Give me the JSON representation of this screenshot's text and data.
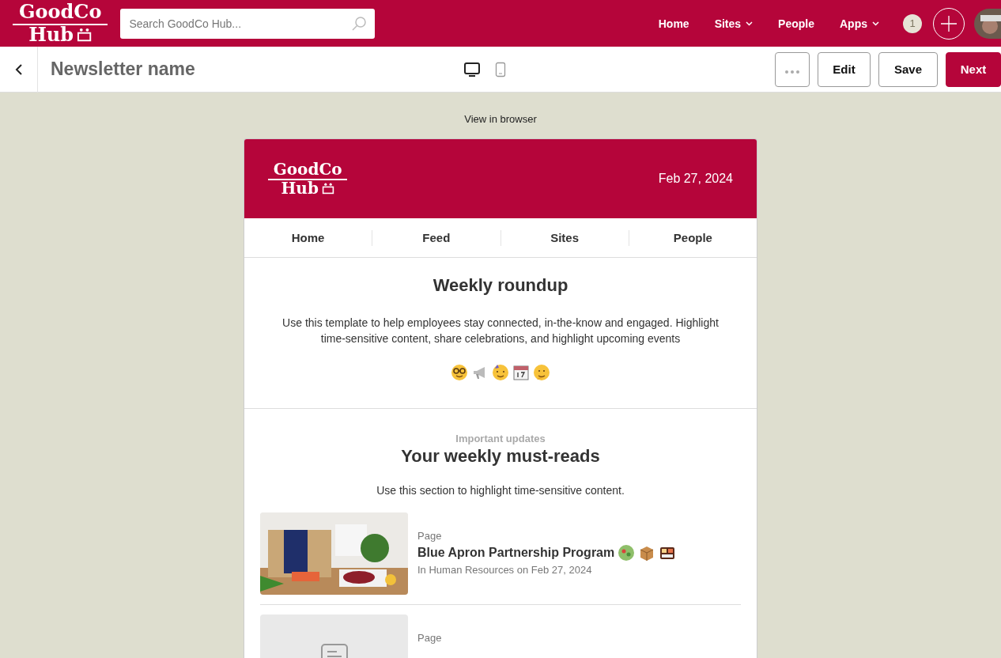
{
  "topbar": {
    "logo": {
      "line1": "GoodCo",
      "line2": "Hub"
    },
    "search": {
      "placeholder": "Search GoodCo Hub..."
    },
    "nav": [
      {
        "label": "Home",
        "dropdown": false
      },
      {
        "label": "Sites",
        "dropdown": true
      },
      {
        "label": "People",
        "dropdown": false
      },
      {
        "label": "Apps",
        "dropdown": true
      }
    ],
    "notification_count": "1"
  },
  "toolbar": {
    "title": "Newsletter name",
    "views": [
      {
        "kind": "desktop",
        "selected": true
      },
      {
        "kind": "mobile",
        "selected": false
      }
    ],
    "buttons": [
      {
        "kind": "more"
      },
      {
        "kind": "outline",
        "label": "Edit"
      },
      {
        "kind": "outline",
        "label": "Save"
      },
      {
        "kind": "primary",
        "label": "Next"
      }
    ]
  },
  "view_in_browser": "View in browser",
  "newsletter": {
    "logo": {
      "line1": "GoodCo",
      "line2": "Hub"
    },
    "date": "Feb 27, 2024",
    "nav": [
      "Home",
      "Feed",
      "Sites",
      "People"
    ],
    "intro": {
      "title": "Weekly roundup",
      "text": "Use this template to help employees stay connected, in-the-know and engaged. Highlight time-sensitive content, share celebrations, and highlight upcoming events"
    },
    "section": {
      "eyebrow": "Important updates",
      "title": "Your weekly must-reads",
      "text": "Use this section to highlight time-sensitive content.",
      "items": [
        {
          "type": "Page",
          "title": "Blue Apron Partnership Program",
          "meta": "In Human Resources on Feb 27, 2024",
          "kind": "picture"
        },
        {
          "type": "Page",
          "kind": "placeholder"
        }
      ]
    }
  }
}
